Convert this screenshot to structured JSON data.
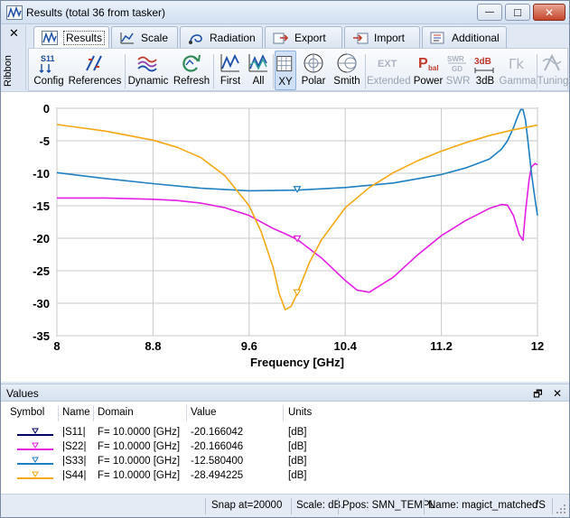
{
  "window": {
    "title": "Results (total 36 from tasker)",
    "minimize_glyph": "—",
    "maximize_glyph": "□",
    "close_glyph": "✕"
  },
  "ribbon": {
    "close_glyph": "✕",
    "label": "Ribbon",
    "tabs": [
      {
        "label": "Results",
        "icon": "results-icon",
        "active": true
      },
      {
        "label": "Scale",
        "icon": "scale-icon"
      },
      {
        "label": "Radiation",
        "icon": "radiation-icon"
      },
      {
        "label": "Export",
        "icon": "export-icon"
      },
      {
        "label": "Import",
        "icon": "import-icon"
      },
      {
        "label": "Additional",
        "icon": "additional-icon"
      }
    ],
    "buttons": [
      {
        "label": "Config",
        "icon": "config-icon",
        "icon_text": "S11"
      },
      {
        "label": "References",
        "icon": "references-icon"
      },
      {
        "label": "Dynamic",
        "icon": "dynamic-icon"
      },
      {
        "label": "Refresh",
        "icon": "refresh-icon"
      },
      {
        "label": "First",
        "icon": "first-icon"
      },
      {
        "label": "All",
        "icon": "all-icon"
      },
      {
        "label": "XY",
        "icon": "xy-grid-icon",
        "active": true
      },
      {
        "label": "Polar",
        "icon": "polar-icon"
      },
      {
        "label": "Smith",
        "icon": "smith-chart-icon"
      },
      {
        "label": "Extended",
        "icon": "extended-icon",
        "icon_text": "EXT",
        "disabled": true
      },
      {
        "label": "Power",
        "icon": "power-icon",
        "icon_text": "P",
        "icon_sub": "bal"
      },
      {
        "label": "SWR",
        "icon": "swr-icon",
        "icon_text": "SWR",
        "icon_sub": "GD",
        "disabled": true
      },
      {
        "label": "3dB",
        "icon": "3db-icon",
        "icon_text": "3dB"
      },
      {
        "label": "Gamma",
        "icon": "gamma-icon",
        "icon_text": "Γk",
        "disabled": true
      },
      {
        "label": "Tuning",
        "icon": "tuning-icon",
        "disabled": true
      }
    ]
  },
  "chart_data": {
    "type": "line",
    "title": "",
    "xlabel": "Frequency [GHz]",
    "ylabel": "",
    "xlim": [
      8,
      12
    ],
    "ylim": [
      -35,
      0
    ],
    "x_ticks": [
      8,
      8.8,
      9.6,
      10.4,
      11.2,
      12
    ],
    "x_tick_labels": [
      "8",
      "8.8",
      "9.6",
      "10.4",
      "11.2",
      "12"
    ],
    "y_ticks": [
      0,
      -5,
      -10,
      -15,
      -20,
      -25,
      -30,
      -35
    ],
    "y_tick_labels": [
      "0",
      "-5",
      "-10",
      "-15",
      "-20",
      "-25",
      "-30",
      "-35"
    ],
    "grid": true,
    "marker_x": 10.0,
    "series": [
      {
        "name": "|S11|",
        "color": "#000066",
        "x": [],
        "y": []
      },
      {
        "name": "|S22|",
        "color": "#e51ee5",
        "x": [
          8.0,
          8.4,
          8.8,
          9.0,
          9.2,
          9.4,
          9.6,
          9.8,
          9.9,
          10.0,
          10.2,
          10.4,
          10.5,
          10.6,
          10.8,
          11.0,
          11.2,
          11.4,
          11.6,
          11.7,
          11.75,
          11.8,
          11.85,
          11.88,
          11.9,
          11.93,
          11.95,
          11.98,
          12.0
        ],
        "y": [
          -13.8,
          -13.8,
          -14.0,
          -14.2,
          -14.6,
          -15.3,
          -16.5,
          -18.5,
          -19.3,
          -20.2,
          -23.0,
          -26.5,
          -28.0,
          -28.3,
          -26.0,
          -22.6,
          -19.6,
          -17.3,
          -15.4,
          -14.8,
          -14.9,
          -16.5,
          -19.5,
          -20.3,
          -16.0,
          -11.0,
          -9.0,
          -8.5,
          -8.7
        ]
      },
      {
        "name": "|S33|",
        "color": "#1f7fc3",
        "x": [
          8.0,
          8.4,
          8.8,
          9.2,
          9.6,
          10.0,
          10.4,
          10.8,
          11.2,
          11.4,
          11.6,
          11.7,
          11.75,
          11.8,
          11.83,
          11.86,
          11.88,
          11.9,
          11.92,
          11.95,
          11.98,
          12.0
        ],
        "y": [
          -9.9,
          -10.8,
          -11.6,
          -12.3,
          -12.7,
          -12.6,
          -12.2,
          -11.5,
          -10.2,
          -9.2,
          -7.8,
          -6.3,
          -5.0,
          -3.0,
          -1.5,
          -0.2,
          -0.2,
          -1.8,
          -5.0,
          -10.0,
          -14.0,
          -16.5
        ]
      },
      {
        "name": "|S44|",
        "color": "#f5a814",
        "x": [
          8.0,
          8.4,
          8.8,
          9.0,
          9.2,
          9.4,
          9.6,
          9.7,
          9.8,
          9.85,
          9.9,
          9.95,
          10.0,
          10.1,
          10.2,
          10.4,
          10.6,
          10.8,
          11.0,
          11.2,
          11.4,
          11.6,
          11.8,
          12.0
        ],
        "y": [
          -2.5,
          -3.5,
          -4.9,
          -6.0,
          -7.6,
          -10.4,
          -15.0,
          -19.0,
          -24.5,
          -28.5,
          -31.0,
          -30.5,
          -28.5,
          -23.8,
          -20.3,
          -15.3,
          -12.2,
          -9.9,
          -8.1,
          -6.6,
          -5.3,
          -4.2,
          -3.3,
          -2.6
        ]
      }
    ]
  },
  "values_panel": {
    "title": "Values",
    "restore_glyph": "🗗",
    "close_glyph": "✕",
    "columns": [
      "Symbol",
      "Name",
      "Domain",
      "Value",
      "Units"
    ],
    "rows": [
      {
        "color": "#000066",
        "name": "|S11|",
        "domain": "F= 10.0000 [GHz]",
        "value": "-20.166042",
        "units": "[dB]"
      },
      {
        "color": "#e51ee5",
        "name": "|S22|",
        "domain": "F= 10.0000 [GHz]",
        "value": "-20.166046",
        "units": "[dB]"
      },
      {
        "color": "#1f7fc3",
        "name": "|S33|",
        "domain": "F= 10.0000 [GHz]",
        "value": "-12.580400",
        "units": "[dB]"
      },
      {
        "color": "#f5a814",
        "name": "|S44|",
        "domain": "F= 10.0000 [GHz]",
        "value": "-28.494225",
        "units": "[dB]"
      }
    ]
  },
  "status": {
    "snap": "Snap at=20000",
    "scale": "Scale: dB.",
    "ppos": "Ppos: SMN_TEMPL",
    "name": "Name: magict_matched",
    "extra": "/S"
  }
}
